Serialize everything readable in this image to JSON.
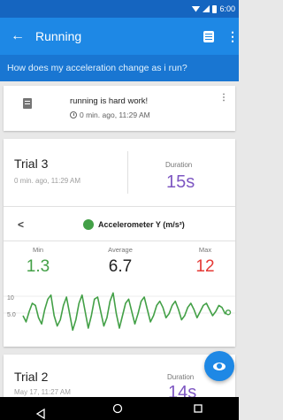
{
  "status": {
    "time": "6:00"
  },
  "appbar": {
    "title": "Running",
    "back_icon": "arrow-back-icon",
    "note_icon": "note-icon",
    "more_icon": "more-vert-icon"
  },
  "question": "How does my acceleration change as i run?",
  "note": {
    "text": "running is hard work!",
    "time": "0 min. ago, 11:29 AM"
  },
  "trial3": {
    "name": "Trial 3",
    "subtitle": "0 min. ago, 11:29 AM",
    "duration_label": "Duration",
    "duration": "15s",
    "sensor": "Accelerometer Y (m/s²)",
    "stats": {
      "min_label": "Min",
      "min": "1.3",
      "avg_label": "Average",
      "avg": "6.7",
      "max_label": "Max",
      "max": "12"
    },
    "colors": {
      "min": "#43a047",
      "avg": "#212121",
      "max": "#e53935"
    }
  },
  "chart_data": {
    "type": "line",
    "ytick_labels": [
      "10",
      "5.0"
    ],
    "ylim": [
      1.3,
      12
    ],
    "series": [
      {
        "color": "#43a047",
        "values": [
          6,
          4.5,
          7,
          9,
          8.5,
          5.5,
          4,
          7.5,
          10,
          11,
          6,
          3.5,
          5,
          8.5,
          10.5,
          6.5,
          2.5,
          5,
          9,
          11,
          7,
          3,
          6,
          10,
          10.5,
          7,
          3.5,
          5.5,
          9.5,
          11.5,
          6.5,
          3,
          6,
          9,
          10,
          7,
          4,
          6.5,
          9.5,
          10.5,
          7.5,
          4.5,
          6,
          8.5,
          9.5,
          8,
          5.5,
          6.5,
          8.5,
          9.5,
          7.5,
          5,
          6,
          8,
          9,
          7.5,
          5.5,
          7,
          8.5,
          9,
          7.5,
          6,
          7,
          8.5,
          8,
          6.5,
          6.8
        ]
      }
    ]
  },
  "trial2": {
    "name": "Trial 2",
    "subtitle": "May 17, 11:27 AM",
    "duration_label": "Duration",
    "duration": "14s"
  },
  "navbar": {
    "back_icon": "nav-back-icon",
    "home_icon": "nav-home-icon",
    "recents_icon": "nav-recents-icon"
  }
}
